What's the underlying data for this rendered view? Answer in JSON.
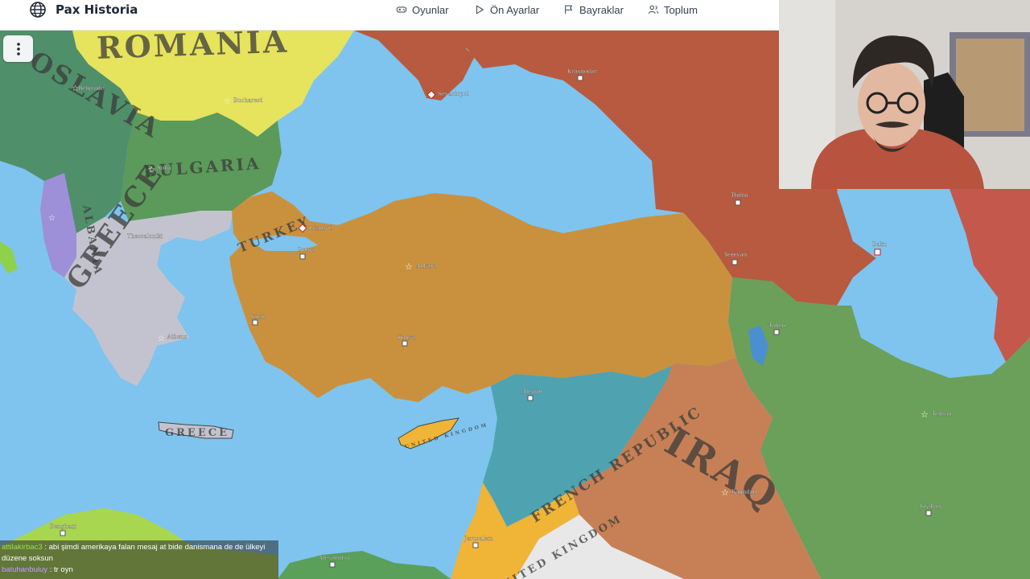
{
  "app": {
    "title": "Pax Historia"
  },
  "nav": {
    "games": "Oyunlar",
    "presets": "Ön Ayarlar",
    "flags": "Bayraklar",
    "community": "Toplum"
  },
  "map": {
    "countries": {
      "romania": "ROMANIA",
      "yugoslavia": "OSLAVIA",
      "bulgaria": "BULGARIA",
      "albania": "ALBANIA",
      "greece": "GREECE",
      "greece_island": "GREECE",
      "turkey": "TURKEY",
      "french_republic": "FRENCH REPUBLIC",
      "iraq": "IRAQ",
      "uk": "UNITED KINGDOM",
      "cyprus_uk": "UNITED KINGDOM"
    },
    "cities": {
      "belgrade": "Belgrade",
      "bucharest": "Bucharest",
      "sofia": "Sofia",
      "tirana": "Tirana",
      "thessaloniki": "Thessaloniki",
      "athens": "Athens",
      "istanbul": "Istanbul",
      "bursa": "Bursa",
      "izmir": "Izmir",
      "ankara": "Ankara",
      "konya": "Konya",
      "sevastopol": "Sevastopol",
      "krasnodar": "Krasnodar",
      "tbilisi": "Tbilisi",
      "yerevan": "Yerevan",
      "baku": "Baku",
      "tabriz": "Tabriz",
      "tehran": "Tehran",
      "isfahan": "Isfahan",
      "baghdad": "Baghdad",
      "aleppo": "Aleppo",
      "jerusalem": "Jerusalem",
      "alexandria": "Alexandria",
      "benghazi": "Benghazi"
    }
  },
  "chat": [
    {
      "user": "attilakirbac3",
      "message": "abi şimdi amerikaya falan mesaj at bide danismana de de ülkeyi düzene soksun"
    },
    {
      "user": "batuhanbuluy",
      "message": "tr oyn"
    }
  ],
  "colors": {
    "sea": "#7ec4ef",
    "turkey": "#c9913e",
    "romania": "#e6e35c",
    "bulgaria": "#5b9a5a",
    "yugoslavia": "#4f8f6a",
    "greece": "#c3c3cf",
    "albania": "#9d8fd8",
    "soviet": "#b85a3f",
    "french": "#4fa3b0",
    "iraq": "#c78055",
    "iran": "#6aa05a",
    "uk": "#f0b437"
  }
}
